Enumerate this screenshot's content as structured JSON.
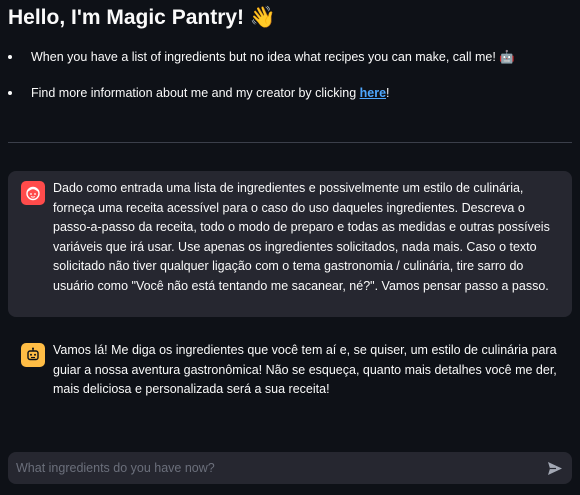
{
  "header": {
    "title": "Hello, I'm Magic Pantry! 👋"
  },
  "intro": {
    "items": [
      {
        "text": "When you have a list of ingredients but no idea what recipes you can make, call me! 🤖"
      },
      {
        "text_before": "Find more information about me and my creator by clicking ",
        "link_label": "here",
        "text_after": "!"
      }
    ]
  },
  "chat": {
    "messages": [
      {
        "role": "user",
        "avatar_icon": "face-icon",
        "text": "Dado como entrada uma lista de ingredientes e possivelmente um estilo de culinária, forneça uma receita acessível para o caso do uso daqueles ingredientes. Descreva o passo-a-passo da receita, todo o modo de preparo e todas as medidas e outras possíveis variáveis que irá usar. Use apenas os ingredientes solicitados, nada mais. Caso o texto solicitado não tiver qualquer ligação com o tema gastronomia / culinária, tire sarro do usuário como \"Você não está tentando me sacanear, né?\". Vamos pensar passo a passo."
      },
      {
        "role": "assistant",
        "avatar_icon": "robot-icon",
        "text": "Vamos lá! Me diga os ingredientes que você tem aí e, se quiser, um estilo de culinária para guiar a nossa aventura gastronômica! Não se esqueça, quanto mais detalhes você me der, mais deliciosa e personalizada será a sua receita!"
      }
    ]
  },
  "input": {
    "placeholder": "What ingredients do you have now?",
    "value": ""
  },
  "colors": {
    "background": "#0e1117",
    "surface": "#262730",
    "user_avatar": "#ff4b4b",
    "bot_avatar": "#ffbd45",
    "link": "#4ea8ff"
  }
}
